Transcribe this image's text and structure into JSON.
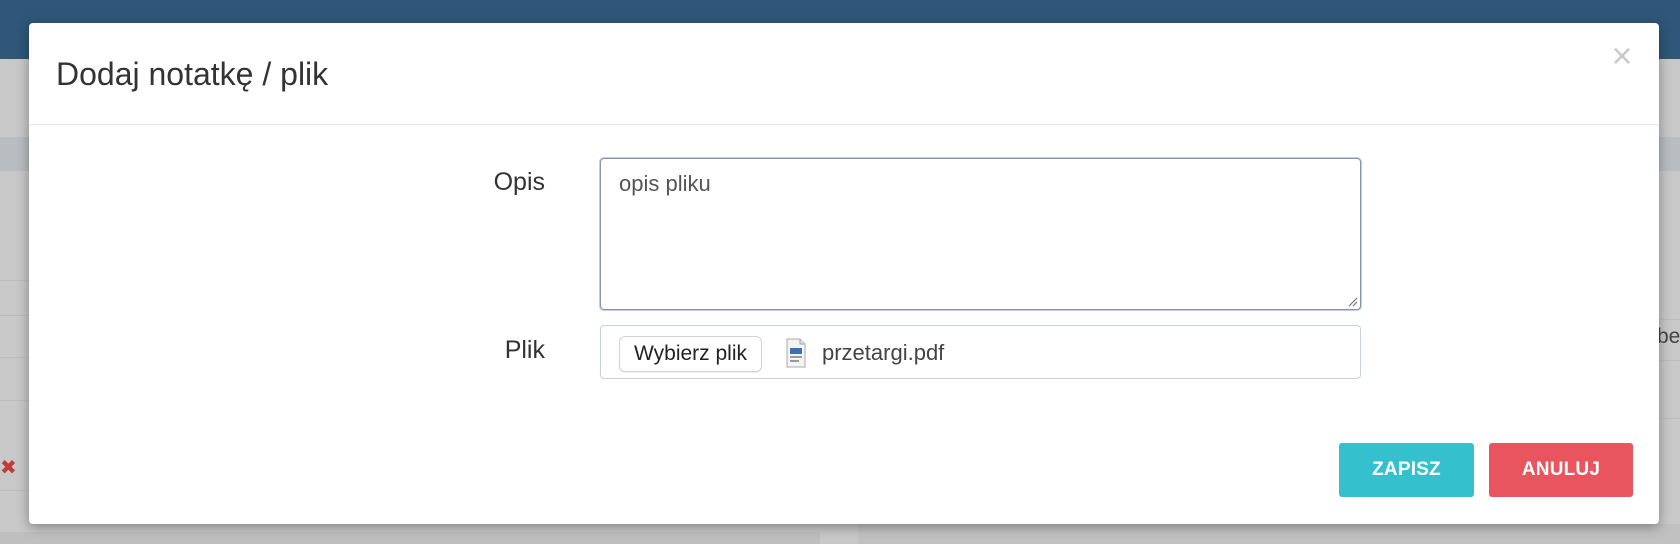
{
  "background": {
    "partial_text": "be",
    "delete_icon": "close-x-icon"
  },
  "modal": {
    "title": "Dodaj notatkę / plik",
    "close_symbol": "×",
    "fields": {
      "description": {
        "label": "Opis",
        "value": "opis pliku"
      },
      "file": {
        "label": "Plik",
        "button_label": "Wybierz plik",
        "file_icon": "pdf-file-icon",
        "file_name": "przetargi.pdf"
      }
    },
    "buttons": {
      "save": "ZAPISZ",
      "cancel": "ANULUJ"
    }
  },
  "colors": {
    "topbar": "#2f5779",
    "save": "#35c0cd",
    "cancel": "#e8555e"
  }
}
